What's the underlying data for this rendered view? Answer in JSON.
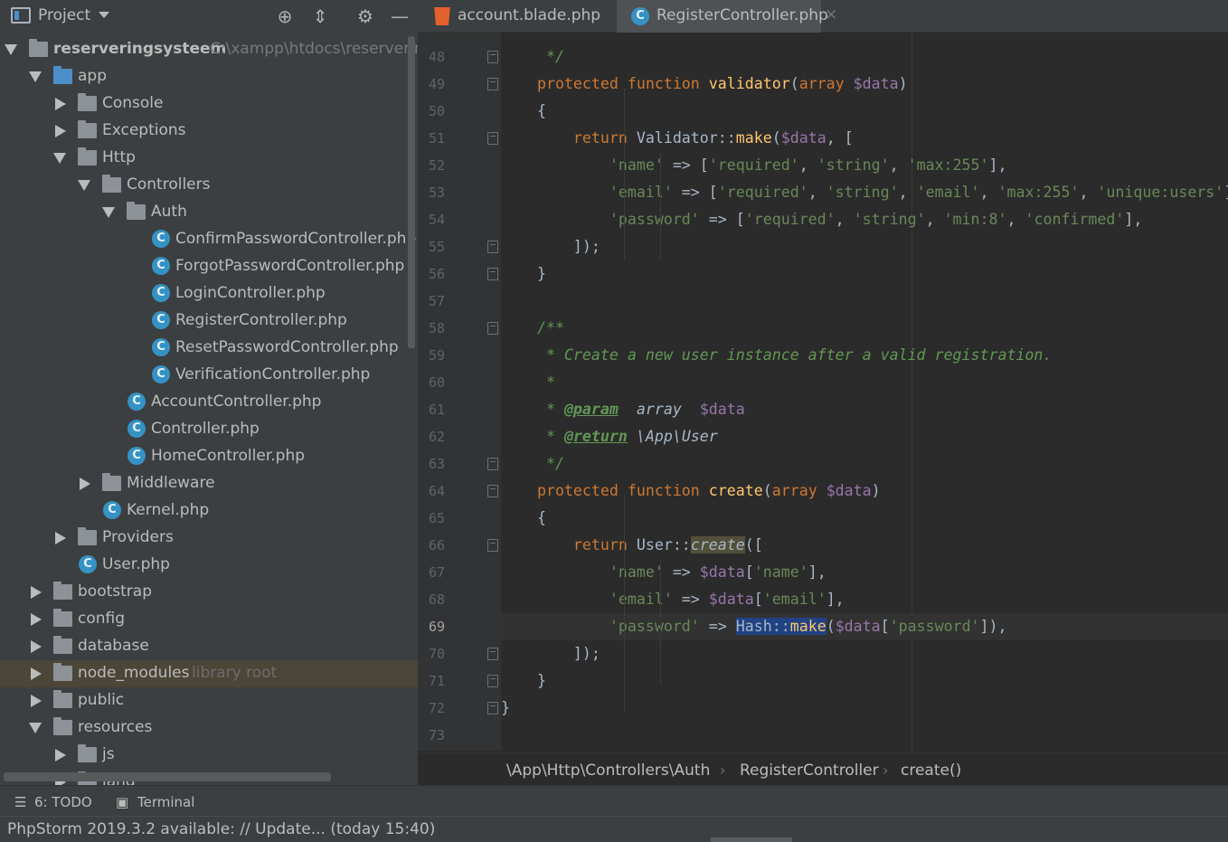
{
  "project_panel": {
    "title": "Project",
    "tools": [
      "locate-icon",
      "collapse-icon",
      "gear-icon",
      "minimize-icon"
    ],
    "root": {
      "name": "reserveringsysteem",
      "path": "C:\\xampp\\htdocs\\reservering"
    },
    "tree": [
      {
        "label": "app",
        "depth": 1,
        "kind": "folder-blue",
        "state": "open"
      },
      {
        "label": "Console",
        "depth": 2,
        "kind": "folder",
        "state": "closed"
      },
      {
        "label": "Exceptions",
        "depth": 2,
        "kind": "folder",
        "state": "closed"
      },
      {
        "label": "Http",
        "depth": 2,
        "kind": "folder",
        "state": "open"
      },
      {
        "label": "Controllers",
        "depth": 3,
        "kind": "folder",
        "state": "open"
      },
      {
        "label": "Auth",
        "depth": 4,
        "kind": "folder",
        "state": "open"
      },
      {
        "label": "ConfirmPasswordController.php",
        "depth": 5,
        "kind": "class"
      },
      {
        "label": "ForgotPasswordController.php",
        "depth": 5,
        "kind": "class"
      },
      {
        "label": "LoginController.php",
        "depth": 5,
        "kind": "class"
      },
      {
        "label": "RegisterController.php",
        "depth": 5,
        "kind": "class"
      },
      {
        "label": "ResetPasswordController.php",
        "depth": 5,
        "kind": "class"
      },
      {
        "label": "VerificationController.php",
        "depth": 5,
        "kind": "class"
      },
      {
        "label": "AccountController.php",
        "depth": 4,
        "kind": "class"
      },
      {
        "label": "Controller.php",
        "depth": 4,
        "kind": "class"
      },
      {
        "label": "HomeController.php",
        "depth": 4,
        "kind": "class"
      },
      {
        "label": "Middleware",
        "depth": 3,
        "kind": "folder",
        "state": "closed"
      },
      {
        "label": "Kernel.php",
        "depth": 3,
        "kind": "class"
      },
      {
        "label": "Providers",
        "depth": 2,
        "kind": "folder",
        "state": "closed"
      },
      {
        "label": "User.php",
        "depth": 2,
        "kind": "class"
      },
      {
        "label": "bootstrap",
        "depth": 1,
        "kind": "folder",
        "state": "closed"
      },
      {
        "label": "config",
        "depth": 1,
        "kind": "folder",
        "state": "closed"
      },
      {
        "label": "database",
        "depth": 1,
        "kind": "folder",
        "state": "closed"
      },
      {
        "label": "node_modules",
        "depth": 1,
        "kind": "folder",
        "state": "closed",
        "note": "library root",
        "highlight": true
      },
      {
        "label": "public",
        "depth": 1,
        "kind": "folder",
        "state": "closed"
      },
      {
        "label": "resources",
        "depth": 1,
        "kind": "folder",
        "state": "open"
      },
      {
        "label": "js",
        "depth": 2,
        "kind": "folder",
        "state": "closed"
      },
      {
        "label": "lang",
        "depth": 2,
        "kind": "folder",
        "state": "closed"
      }
    ]
  },
  "editor": {
    "tabs": [
      {
        "label": "account.blade.php",
        "icon": "html-file-icon",
        "active": false
      },
      {
        "label": "RegisterController.php",
        "icon": "php-class-icon",
        "active": true
      }
    ],
    "current_line": "69",
    "lines": [
      {
        "n": "48",
        "t": [
          [
            "cm",
            "     */"
          ]
        ]
      },
      {
        "n": "49",
        "t": [
          [
            "kw",
            "    protected function "
          ],
          [
            "fn",
            "validator"
          ],
          [
            "plain",
            "("
          ],
          [
            "kw",
            "array "
          ],
          [
            "var",
            "$data"
          ],
          [
            "plain",
            ")"
          ]
        ]
      },
      {
        "n": "50",
        "t": [
          [
            "plain",
            "    {"
          ]
        ]
      },
      {
        "n": "51",
        "t": [
          [
            "kw",
            "        return "
          ],
          [
            "plain",
            "Validator::"
          ],
          [
            "fn",
            "make"
          ],
          [
            "plain",
            "("
          ],
          [
            "var",
            "$data"
          ],
          [
            "plain",
            ", ["
          ]
        ]
      },
      {
        "n": "52",
        "t": [
          [
            "str",
            "            'name'"
          ],
          [
            "plain",
            " => ["
          ],
          [
            "str",
            "'required'"
          ],
          [
            "plain",
            ", "
          ],
          [
            "str",
            "'string'"
          ],
          [
            "plain",
            ", "
          ],
          [
            "str",
            "'max:255'"
          ],
          [
            "plain",
            "],"
          ]
        ]
      },
      {
        "n": "53",
        "t": [
          [
            "str",
            "            'email'"
          ],
          [
            "plain",
            " => ["
          ],
          [
            "str",
            "'required'"
          ],
          [
            "plain",
            ", "
          ],
          [
            "str",
            "'string'"
          ],
          [
            "plain",
            ", "
          ],
          [
            "str",
            "'email'"
          ],
          [
            "plain",
            ", "
          ],
          [
            "str",
            "'max:255'"
          ],
          [
            "plain",
            ", "
          ],
          [
            "str",
            "'unique:users'"
          ],
          [
            "plain",
            "],"
          ]
        ]
      },
      {
        "n": "54",
        "t": [
          [
            "str",
            "            'password'"
          ],
          [
            "plain",
            " => ["
          ],
          [
            "str",
            "'required'"
          ],
          [
            "plain",
            ", "
          ],
          [
            "str",
            "'string'"
          ],
          [
            "plain",
            ", "
          ],
          [
            "str",
            "'min:8'"
          ],
          [
            "plain",
            ", "
          ],
          [
            "str",
            "'confirmed'"
          ],
          [
            "plain",
            "],"
          ]
        ]
      },
      {
        "n": "55",
        "t": [
          [
            "plain",
            "        ]);"
          ]
        ]
      },
      {
        "n": "56",
        "t": [
          [
            "plain",
            "    }"
          ]
        ]
      },
      {
        "n": "57",
        "t": []
      },
      {
        "n": "58",
        "t": [
          [
            "cm",
            "    /**"
          ]
        ]
      },
      {
        "n": "59",
        "t": [
          [
            "cm",
            "     * Create a new user instance after a valid registration."
          ]
        ]
      },
      {
        "n": "60",
        "t": [
          [
            "cm",
            "     *"
          ]
        ]
      },
      {
        "n": "61",
        "t": [
          [
            "cm",
            "     * "
          ],
          [
            "tag",
            "@param"
          ],
          [
            "ita",
            "  array  "
          ],
          [
            "var",
            "$data"
          ]
        ]
      },
      {
        "n": "62",
        "t": [
          [
            "cm",
            "     * "
          ],
          [
            "tag",
            "@return"
          ],
          [
            "ita",
            " \\App\\User"
          ]
        ]
      },
      {
        "n": "63",
        "t": [
          [
            "cm",
            "     */"
          ]
        ]
      },
      {
        "n": "64",
        "t": [
          [
            "kw",
            "    protected function "
          ],
          [
            "fn",
            "create"
          ],
          [
            "plain",
            "("
          ],
          [
            "kw",
            "array "
          ],
          [
            "var",
            "$data"
          ],
          [
            "plain",
            ")"
          ]
        ]
      },
      {
        "n": "65",
        "t": [
          [
            "plain",
            "    {"
          ]
        ]
      },
      {
        "n": "66",
        "t": [
          [
            "kw",
            "        return "
          ],
          [
            "plain",
            "User::"
          ],
          [
            "hlfn",
            "create"
          ],
          [
            "plain",
            "(["
          ]
        ]
      },
      {
        "n": "67",
        "t": [
          [
            "str",
            "            'name'"
          ],
          [
            "plain",
            " => "
          ],
          [
            "var",
            "$data"
          ],
          [
            "plain",
            "["
          ],
          [
            "str",
            "'name'"
          ],
          [
            "plain",
            "],"
          ]
        ]
      },
      {
        "n": "68",
        "t": [
          [
            "str",
            "            'email'"
          ],
          [
            "plain",
            " => "
          ],
          [
            "var",
            "$data"
          ],
          [
            "plain",
            "["
          ],
          [
            "str",
            "'email'"
          ],
          [
            "plain",
            "],"
          ]
        ]
      },
      {
        "n": "69",
        "t": [
          [
            "str",
            "            'password'"
          ],
          [
            "plain",
            " => "
          ],
          [
            "sel",
            "Hash::"
          ],
          [
            "selfn",
            "make"
          ],
          [
            "plain",
            "("
          ],
          [
            "var",
            "$data"
          ],
          [
            "plain",
            "["
          ],
          [
            "str",
            "'password'"
          ],
          [
            "plain",
            "]),"
          ]
        ]
      },
      {
        "n": "70",
        "t": [
          [
            "plain",
            "        ]);"
          ]
        ]
      },
      {
        "n": "71",
        "t": [
          [
            "plain",
            "    }"
          ]
        ]
      },
      {
        "n": "72",
        "t": [
          [
            "plain",
            "}"
          ]
        ]
      },
      {
        "n": "73",
        "t": []
      }
    ],
    "breadcrumb": [
      "\\App\\Http\\Controllers\\Auth",
      "RegisterController",
      "create()"
    ]
  },
  "bottom_tools": [
    {
      "label": "6: TODO",
      "icon": "list-icon"
    },
    {
      "label": "Terminal",
      "icon": "terminal-icon"
    }
  ],
  "status": "PhpStorm 2019.3.2 available: // Update... (today 15:40)"
}
